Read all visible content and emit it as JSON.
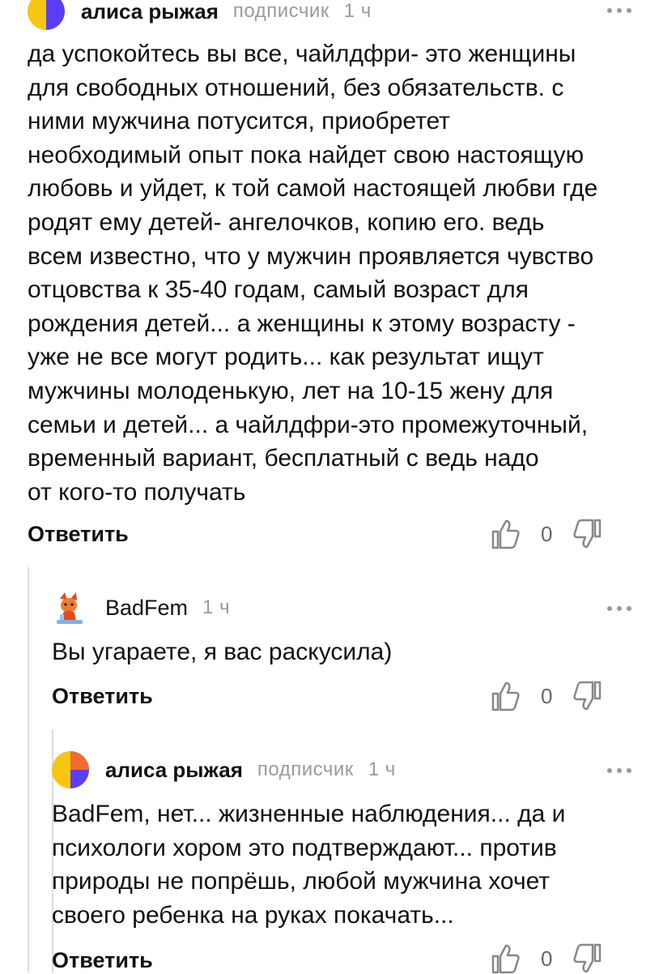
{
  "comments": [
    {
      "author": "алиса рыжая",
      "role": "подписчик",
      "time": "1 ч",
      "text": "да успокойтесь вы все, чайлдфри- это женщины\nдля свободных отношений, без обязательств. с\nними мужчина потусится, приобретет\nнеобходимый опыт пока найдет свою настоящую\nлюбовь и уйдет, к той самой настоящей любви где\nродят ему детей- ангелочков, копию его. ведь\nвсем известно, что у мужчин проявляется чувство\nотцовства к 35-40 годам, самый возраст для\nрождения детей...  а женщины к этому возрасту -\nуже не все могут родить...  как результат ищут\nмужчины молоденькую, лет на 10-15 жену для\nсемьи и детей... а чайлдфри-это промежуточный,\nвременный вариант, бесплатный с      ведь надо\nот кого-то получать",
      "reply_label": "Ответить",
      "likes": "0"
    },
    {
      "author": "BadFem",
      "time": "1 ч",
      "text": "Вы угараете, я вас раскусила)",
      "reply_label": "Ответить",
      "likes": "0"
    },
    {
      "author": "алиса рыжая",
      "role": "подписчик",
      "time": "1 ч",
      "text": "BadFem, нет...  жизненные наблюдения... да и\nпсихологи хором это подтверждают...  против\nприроды не попрёшь, любой мужчина хочет\nсвоего ребенка на руках покачать...",
      "reply_label": "Ответить",
      "likes": "0"
    }
  ],
  "icons": {
    "like": "thumbs-up-icon",
    "dislike": "thumbs-down-icon",
    "more": "more-dots-icon"
  },
  "colors": {
    "avatar_yellow": "#f7c612",
    "avatar_blue": "#5b3df5",
    "avatar_orange": "#f26a2e",
    "meta_gray": "#9a9a9a"
  }
}
